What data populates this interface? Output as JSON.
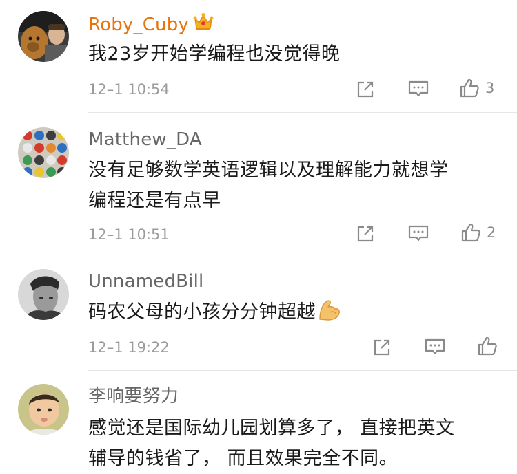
{
  "comments": [
    {
      "username": "Roby_Cuby",
      "vip": true,
      "avatar_icon": "avatar-dog-and-man",
      "badge_icon": "crown-icon",
      "lines": [
        "我23岁开始学编程也没觉得晚"
      ],
      "time": "12–1 10:54",
      "likes": "3"
    },
    {
      "username": "Matthew_DA",
      "vip": false,
      "avatar_icon": "avatar-colorful-helmets",
      "lines": [
        "没有足够数学英语逻辑以及理解能力就想学",
        "编程还是有点早"
      ],
      "time": "12–1 10:51",
      "likes": "2"
    },
    {
      "username": "UnnamedBill",
      "vip": false,
      "avatar_icon": "avatar-bw-portrait",
      "lines": [
        "码农父母的小孩分分钟超越"
      ],
      "emoji": "flexed-biceps-emoji",
      "time": "12–1 19:22",
      "likes": ""
    },
    {
      "username": "李响要努力",
      "vip": false,
      "avatar_icon": "avatar-baby",
      "lines": [
        "感觉还是国际幼儿园划算多了， 直接把英文",
        "辅导的钱省了， 而且效果完全不同。"
      ]
    }
  ],
  "icons": {
    "share": "share-icon",
    "reply": "comment-icon",
    "like": "thumbs-up-icon"
  },
  "colors": {
    "vip_name": "#e8740c",
    "name": "#666666",
    "time": "#9b9b9b",
    "icon": "#8a8a8a",
    "divider": "#e6e6e6"
  }
}
